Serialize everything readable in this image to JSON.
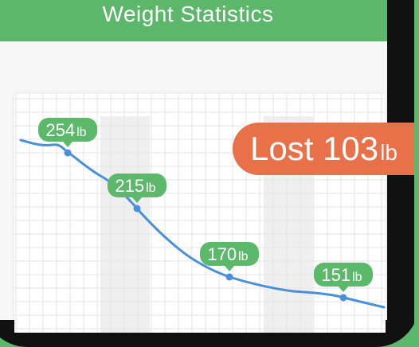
{
  "header": {
    "title": "Weight Statistics"
  },
  "badge": {
    "label": "Lost",
    "value": "103",
    "unit": "lb"
  },
  "colors": {
    "background": "#5cb86a",
    "header": "#5db76b",
    "line": "#4a90d9",
    "point_label": "#5cb86a",
    "lost_badge": "#e8714a"
  },
  "chart_data": {
    "type": "line",
    "unit": "lb",
    "points": [
      {
        "label": "254",
        "unit": "lb"
      },
      {
        "label": "215",
        "unit": "lb"
      },
      {
        "label": "170",
        "unit": "lb"
      },
      {
        "label": "151",
        "unit": "lb"
      }
    ],
    "values": [
      254,
      215,
      170,
      151
    ]
  }
}
